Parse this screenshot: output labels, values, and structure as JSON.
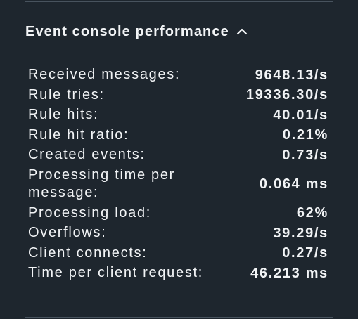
{
  "panel": {
    "title": "Event console performance",
    "toggle_icon": "chevron-up-icon"
  },
  "stats": [
    {
      "label": "Received messages:",
      "value": "9648.13/s"
    },
    {
      "label": "Rule tries:",
      "value": "19336.30/s"
    },
    {
      "label": "Rule hits:",
      "value": "40.01/s"
    },
    {
      "label": "Rule hit ratio:",
      "value": "0.21%"
    },
    {
      "label": "Created events:",
      "value": "0.73/s"
    },
    {
      "label": "Processing time per message:",
      "value": "0.064 ms"
    },
    {
      "label": "Processing load:",
      "value": "62%"
    },
    {
      "label": "Overflows:",
      "value": "39.29/s"
    },
    {
      "label": "Client connects:",
      "value": "0.27/s"
    },
    {
      "label": "Time per client request:",
      "value": "46.213 ms"
    }
  ],
  "colors": {
    "background": "#1e262e",
    "text": "#f2f4f6",
    "divider": "#48535e"
  }
}
